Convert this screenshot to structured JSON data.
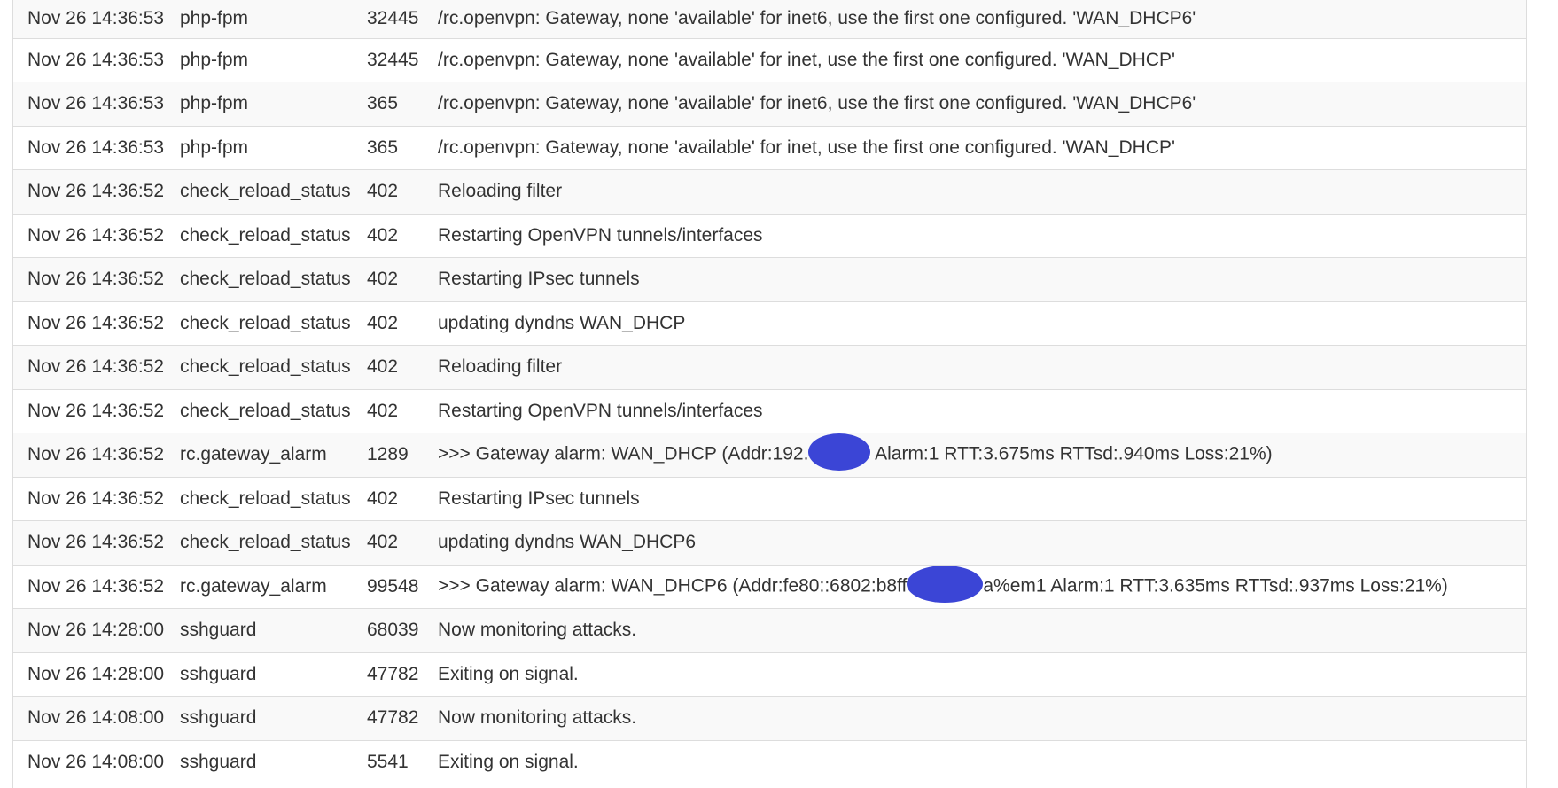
{
  "log": {
    "rows": [
      {
        "time": "Nov 26 14:36:53",
        "process": "php-fpm",
        "pid": "32445",
        "message": "/rc.openvpn: Gateway, none 'available' for inet6, use the first one configured. 'WAN_DHCP6'"
      },
      {
        "time": "Nov 26 14:36:53",
        "process": "php-fpm",
        "pid": "32445",
        "message": "/rc.openvpn: Gateway, none 'available' for inet, use the first one configured. 'WAN_DHCP'"
      },
      {
        "time": "Nov 26 14:36:53",
        "process": "php-fpm",
        "pid": "365",
        "message": "/rc.openvpn: Gateway, none 'available' for inet6, use the first one configured. 'WAN_DHCP6'"
      },
      {
        "time": "Nov 26 14:36:53",
        "process": "php-fpm",
        "pid": "365",
        "message": "/rc.openvpn: Gateway, none 'available' for inet, use the first one configured. 'WAN_DHCP'"
      },
      {
        "time": "Nov 26 14:36:52",
        "process": "check_reload_status",
        "pid": "402",
        "message": "Reloading filter"
      },
      {
        "time": "Nov 26 14:36:52",
        "process": "check_reload_status",
        "pid": "402",
        "message": "Restarting OpenVPN tunnels/interfaces"
      },
      {
        "time": "Nov 26 14:36:52",
        "process": "check_reload_status",
        "pid": "402",
        "message": "Restarting IPsec tunnels"
      },
      {
        "time": "Nov 26 14:36:52",
        "process": "check_reload_status",
        "pid": "402",
        "message": "updating dyndns WAN_DHCP"
      },
      {
        "time": "Nov 26 14:36:52",
        "process": "check_reload_status",
        "pid": "402",
        "message": "Reloading filter"
      },
      {
        "time": "Nov 26 14:36:52",
        "process": "check_reload_status",
        "pid": "402",
        "message": "Restarting OpenVPN tunnels/interfaces"
      },
      {
        "time": "Nov 26 14:36:52",
        "process": "rc.gateway_alarm",
        "pid": "1289",
        "message_pre": ">>> Gateway alarm: WAN_DHCP (Addr:192.",
        "message_post": " Alarm:1 RTT:3.675ms RTTsd:.940ms Loss:21%)"
      },
      {
        "time": "Nov 26 14:36:52",
        "process": "check_reload_status",
        "pid": "402",
        "message": "Restarting IPsec tunnels"
      },
      {
        "time": "Nov 26 14:36:52",
        "process": "check_reload_status",
        "pid": "402",
        "message": "updating dyndns WAN_DHCP6"
      },
      {
        "time": "Nov 26 14:36:52",
        "process": "rc.gateway_alarm",
        "pid": "99548",
        "message_pre": ">>> Gateway alarm: WAN_DHCP6 (Addr:fe80::6802:b8ff",
        "message_post": "a%em1 Alarm:1 RTT:3.635ms RTTsd:.937ms Loss:21%)"
      },
      {
        "time": "Nov 26 14:28:00",
        "process": "sshguard",
        "pid": "68039",
        "message": "Now monitoring attacks."
      },
      {
        "time": "Nov 26 14:28:00",
        "process": "sshguard",
        "pid": "47782",
        "message": "Exiting on signal."
      },
      {
        "time": "Nov 26 14:08:00",
        "process": "sshguard",
        "pid": "47782",
        "message": "Now monitoring attacks."
      },
      {
        "time": "Nov 26 14:08:00",
        "process": "sshguard",
        "pid": "5541",
        "message": "Exiting on signal."
      }
    ]
  },
  "colors": {
    "redaction": "#3b45d6",
    "row_stripe": "#f9f9f9",
    "border": "#dddddd",
    "text": "#333333"
  }
}
